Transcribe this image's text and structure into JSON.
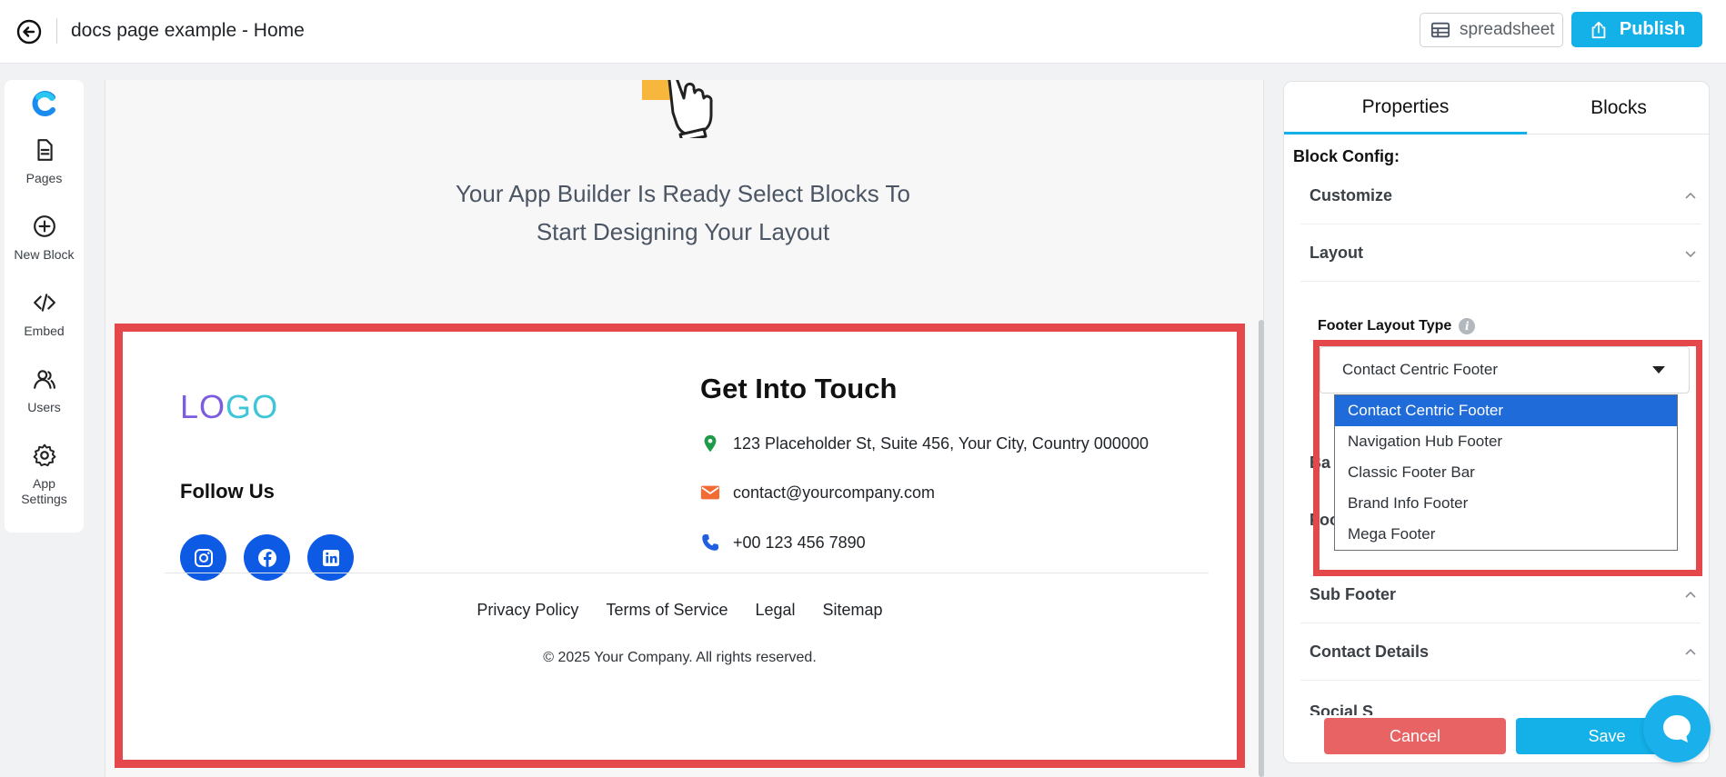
{
  "header": {
    "title": "docs page example - Home",
    "spreadsheet_label": "spreadsheet",
    "publish_label": "Publish"
  },
  "sidebar": {
    "items": [
      {
        "label": "Pages",
        "icon": "pages-icon"
      },
      {
        "label": "New Block",
        "icon": "plus-circle-icon"
      },
      {
        "label": "Embed",
        "icon": "code-icon"
      },
      {
        "label": "Users",
        "icon": "users-icon"
      },
      {
        "label": "App Settings",
        "icon": "gear-icon"
      }
    ]
  },
  "canvas": {
    "ready_line1": "Your App Builder Is Ready Select Blocks To",
    "ready_line2": "Start Designing Your Layout",
    "footer": {
      "logo": {
        "l": "L",
        "o1": "O",
        "g": "G",
        "o2": "O"
      },
      "follow_title": "Follow Us",
      "socials": [
        "instagram-icon",
        "facebook-icon",
        "linkedin-icon"
      ],
      "touch_title": "Get Into Touch",
      "address": "123 Placeholder St, Suite 456, Your City, Country 000000",
      "email": "contact@yourcompany.com",
      "phone": "+00 123 456 7890",
      "links": [
        "Privacy Policy",
        "Terms of Service",
        "Legal",
        "Sitemap"
      ],
      "copyright": "© 2025 Your Company. All rights reserved."
    }
  },
  "panel": {
    "tabs": {
      "properties": "Properties",
      "blocks": "Blocks"
    },
    "block_config": "Block Config:",
    "sections": {
      "customize": "Customize",
      "layout": "Layout",
      "sub_footer": "Sub Footer",
      "contact_details": "Contact Details"
    },
    "partials": {
      "ba": "Ba",
      "foo": "Foo",
      "social": "Social S"
    },
    "footer_layout_type": "Footer Layout Type",
    "select_value": "Contact Centric Footer",
    "options": [
      "Contact Centric Footer",
      "Navigation Hub Footer",
      "Classic Footer Bar",
      "Brand Info Footer",
      "Mega Footer"
    ],
    "cancel_label": "Cancel",
    "save_label": "Save"
  },
  "colors": {
    "accent": "#14b0e8",
    "highlight": "#e5484a",
    "social": "#0d5ae5",
    "selected_option": "#1f6bd9"
  }
}
